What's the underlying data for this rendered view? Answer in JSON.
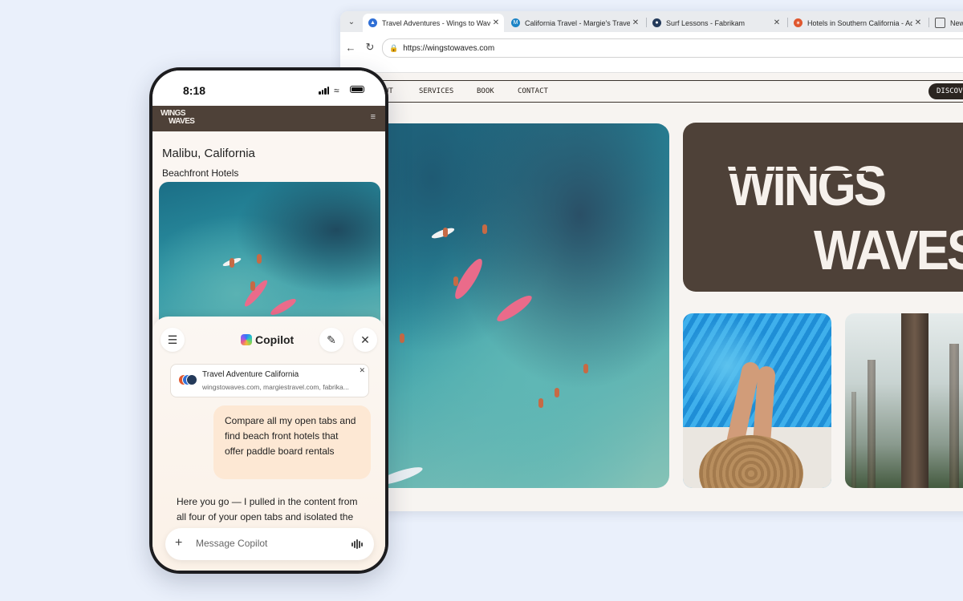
{
  "browser": {
    "tabs": [
      {
        "title": "Travel Adventures - Wings to Waves",
        "active": true
      },
      {
        "title": "California Travel - Margie's Travel",
        "active": false
      },
      {
        "title": "Surf Lessons - Fabrikam",
        "active": false
      },
      {
        "title": "Hotels in Southern California - Ad",
        "active": false
      },
      {
        "title": "New T",
        "active": false
      }
    ],
    "url": "https://wingstowaves.com",
    "site_nav": [
      "UT",
      "SERVICES",
      "BOOK",
      "CONTACT"
    ],
    "discover_label": "DISCOVE",
    "brand": {
      "line1": "WINGS",
      "line2": "WAVES"
    }
  },
  "phone": {
    "time": "8:18",
    "logo": {
      "line1": "WINGS",
      "line2": "WAVES"
    },
    "location_title": "Malibu, California",
    "location_subtitle": "Beachfront Hotels",
    "copilot": {
      "title": "Copilot",
      "context_card": {
        "title": "Travel Adventure California",
        "sources": "wingstowaves.com, margiestravel.com, fabrika..."
      },
      "user_message": "Compare all my open tabs and find beach front hotels that offer paddle board rentals",
      "assistant_message": "Here you go — I pulled in the content from all four of your open tabs and isolated the",
      "composer_placeholder": "Message Copilot"
    }
  },
  "colors": {
    "page_bg": "#eaf0fb",
    "brand_brown": "#4e4138",
    "user_bubble": "#fde8d4",
    "accent_dark": "#2b2520"
  },
  "icons": [
    "tab-dropdown-icon",
    "back-icon",
    "reload-icon",
    "lock-icon",
    "close-icon",
    "tune-icon",
    "menu-icon",
    "new-chat-icon",
    "plus-icon",
    "voice-icon"
  ]
}
